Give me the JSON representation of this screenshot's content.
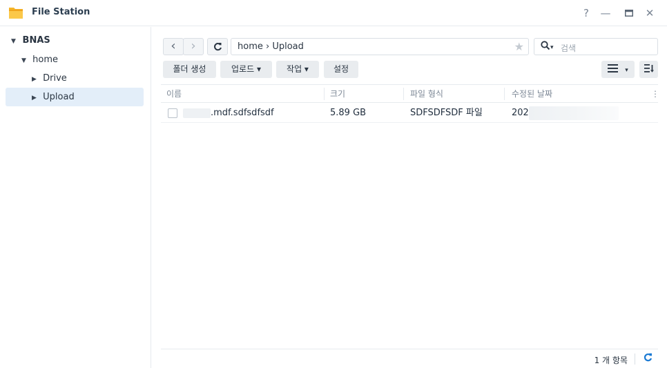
{
  "window": {
    "title": "File Station",
    "controls": {
      "help": "?",
      "minimize": "—",
      "maximize": "▭",
      "close": "✕"
    }
  },
  "sidebar": {
    "items": [
      {
        "label": "BNAS",
        "arrow": "▼",
        "level": 0,
        "bold": true
      },
      {
        "label": "home",
        "arrow": "▼",
        "level": 1
      },
      {
        "label": "Drive",
        "arrow": "▶",
        "level": 2
      },
      {
        "label": "Upload",
        "arrow": "▶",
        "level": 2,
        "selected": true
      }
    ]
  },
  "toolbar": {
    "back": "‹",
    "forward": "›",
    "refresh": "C",
    "path": "home › Upload",
    "favorite_icon": "star-icon",
    "search_placeholder": "검색",
    "search_caret": "▾",
    "create_folder": "폴더 생성",
    "upload": "업로드 ▾",
    "action": "작업 ▾",
    "settings": "설정",
    "view_caret": "▾"
  },
  "table": {
    "columns": [
      "이름",
      "크기",
      "파일 형식",
      "수정된 날짜"
    ],
    "more": "⋮",
    "rows": [
      {
        "name": ".mdf.sdfsdfsdf",
        "size": "5.89 GB",
        "type": "SDFSDFSDF 파일",
        "modified": "202"
      }
    ]
  },
  "footer": {
    "count": "1 개 항목",
    "refresh": "C"
  },
  "colors": {
    "accent": "#1b7ad3",
    "selected_bg": "#e3eef9",
    "folder": "#f5b529"
  }
}
